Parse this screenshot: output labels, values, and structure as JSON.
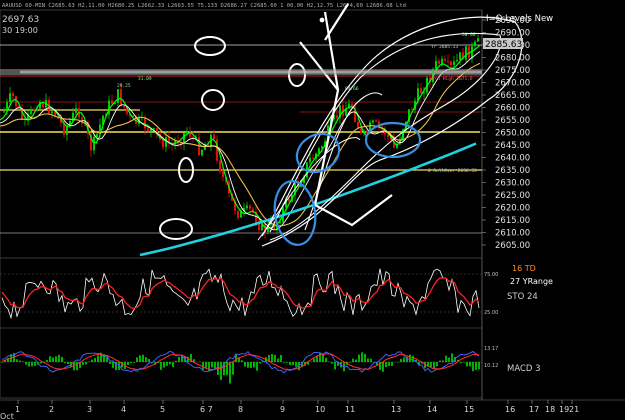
{
  "header": {
    "info_line": "AAUUSD 60-MIN C2685.63 H2,11.00 H2680.25 L2662.33 L2663.55 T5.133 D2686.27 C2685.60 1 00.00 H2,12.75 L2674,60 L2686.08 Ltd",
    "last_price": "2697.63",
    "time": "30 19:00"
  },
  "levels_title": "I=Q Levels New",
  "price_axis": {
    "ticks": [
      "2695.00",
      "2690.00",
      "2685.00",
      "2680.00",
      "2675.00",
      "2670.00",
      "2665.00",
      "2660.00",
      "2655.00",
      "2650.00",
      "2645.00",
      "2640.00",
      "2635.00",
      "2630.00",
      "2625.00",
      "2620.00",
      "2615.00",
      "2610.00",
      "2605.00"
    ],
    "current_price": "2885.63"
  },
  "level_labels": [
    {
      "text": "Yr 2685.13",
      "color": "#c8c8c8"
    },
    {
      "text": "Prd High 2671.8",
      "color": "#ff6060"
    },
    {
      "text": "0 RollOver 2636.33",
      "color": "#c8c8c8"
    }
  ],
  "chart_annotations": [
    "50.00",
    "84.66",
    "29.25",
    "31.09"
  ],
  "stochastic": {
    "label": "STO 24",
    "td_label": "16 TD",
    "range_label": "27 YRange",
    "ticks": [
      "75.00",
      "25.00"
    ]
  },
  "macd": {
    "label": "MACD 3",
    "ticks": [
      "13.17",
      "10.12"
    ]
  },
  "x_axis": {
    "ticks": [
      "1",
      "2",
      "3",
      "4",
      "5",
      "6 7",
      "8",
      "9",
      "10",
      "11",
      "13",
      "14",
      "15",
      "16",
      "17",
      "18",
      "19",
      "21"
    ],
    "month": "Oct"
  },
  "colors": {
    "background": "#000000",
    "bull_candle": "#00d000",
    "bear_candle": "#e01010",
    "ema_fast": "#00ff00",
    "ema_slow": "#ffffff",
    "sma_yellow": "#e8c040",
    "sma_cyan": "#20d0e0",
    "level_yellow": "#f0e060",
    "level_red": "#ff3030",
    "level_gray": "#a0a0a0",
    "stochastic_k": "#ffffff",
    "stochastic_d": "#ff2020",
    "td_orange": "#ff8a20",
    "macd_hist": "#00e000",
    "macd_line": "#4060ff",
    "macd_signal": "#ff3030",
    "annotation_circle": "#ffffff",
    "annotation_ellipse_blue": "#3a8de0"
  }
}
